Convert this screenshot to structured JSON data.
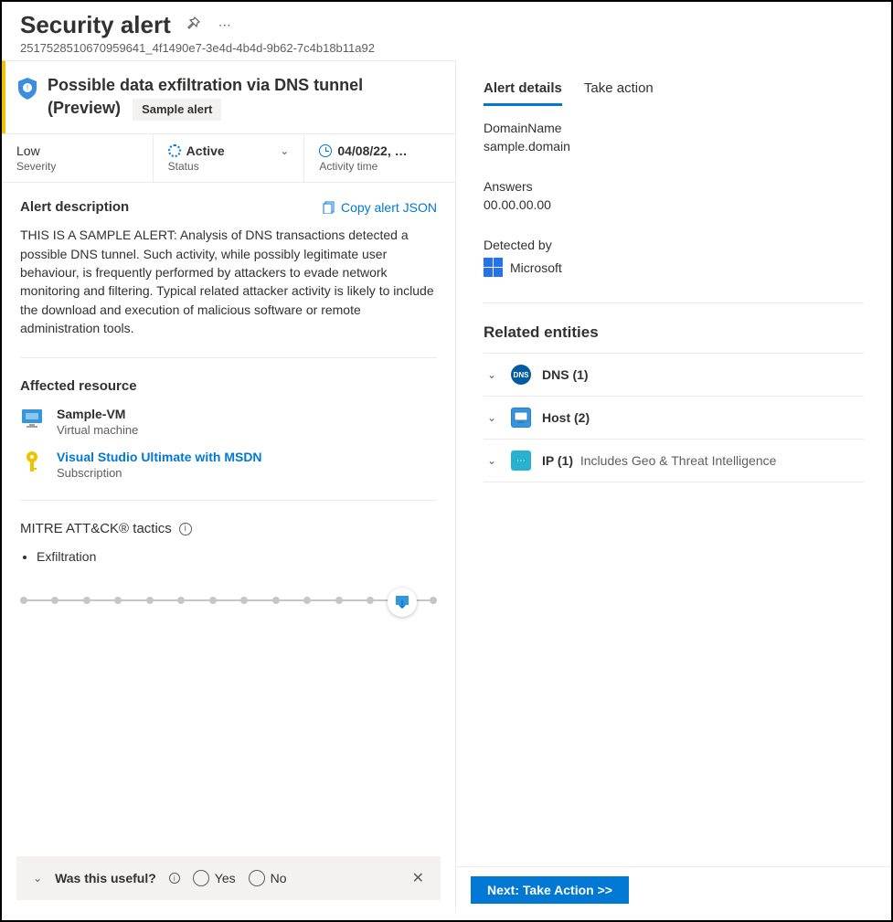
{
  "header": {
    "title": "Security alert",
    "id": "2517528510670959641_4f1490e7-3e4d-4b4d-9b62-7c4b18b11a92"
  },
  "alert": {
    "title_line1": "Possible data exfiltration via DNS tunnel",
    "title_line2": "(Preview)",
    "sample_badge": "Sample alert"
  },
  "props": {
    "severity": {
      "value": "Low",
      "label": "Severity"
    },
    "status": {
      "value": "Active",
      "label": "Status"
    },
    "time": {
      "value": "04/08/22, …",
      "label": "Activity time"
    }
  },
  "description": {
    "heading": "Alert description",
    "copy_label": "Copy alert JSON",
    "text": "THIS IS A SAMPLE ALERT: Analysis of DNS transactions detected a possible DNS tunnel. Such activity, while possibly legitimate user behaviour, is frequently performed by attackers to evade network monitoring and filtering. Typical related attacker activity is likely to include the download and execution of malicious software or remote administration tools."
  },
  "affected": {
    "heading": "Affected resource",
    "items": [
      {
        "name": "Sample-VM",
        "type": "Virtual machine",
        "link": false,
        "icon": "vm"
      },
      {
        "name": "Visual Studio Ultimate with MSDN",
        "type": "Subscription",
        "link": true,
        "icon": "key"
      }
    ]
  },
  "mitre": {
    "heading": "MITRE ATT&CK® tactics",
    "tactics": [
      "Exfiltration"
    ]
  },
  "feedback": {
    "question": "Was this useful?",
    "yes": "Yes",
    "no": "No"
  },
  "tabs": {
    "details": "Alert details",
    "action": "Take action"
  },
  "details": {
    "domain_label": "DomainName",
    "domain_value": "sample.domain",
    "answers_label": "Answers",
    "answers_value": "00.00.00.00",
    "detected_label": "Detected by",
    "detected_value": "Microsoft"
  },
  "related": {
    "heading": "Related entities",
    "items": [
      {
        "icon": "dns",
        "label": "DNS (1)",
        "suffix": ""
      },
      {
        "icon": "host",
        "label": "Host (2)",
        "suffix": ""
      },
      {
        "icon": "ip",
        "label": "IP (1)",
        "suffix": "Includes Geo & Threat Intelligence"
      }
    ]
  },
  "next_button": "Next: Take Action >>"
}
